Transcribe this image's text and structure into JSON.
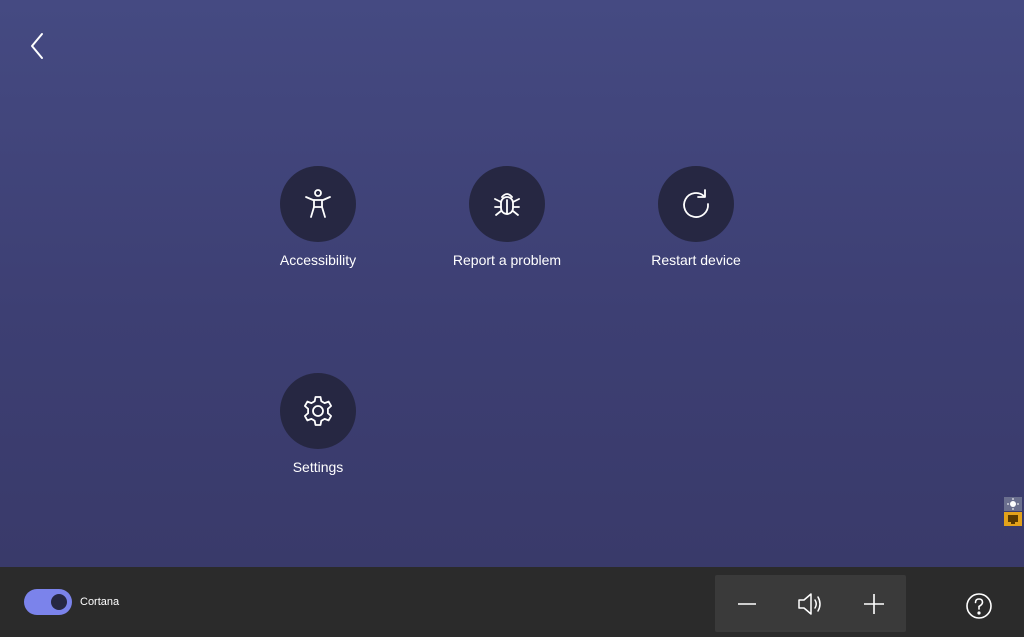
{
  "nav": {
    "back_icon": "chevron-left-icon"
  },
  "tiles": [
    {
      "label": "Accessibility",
      "icon": "accessibility-icon"
    },
    {
      "label": "Report a problem",
      "icon": "bug-icon"
    },
    {
      "label": "Restart device",
      "icon": "restart-icon"
    },
    {
      "label": "Settings",
      "icon": "gear-icon"
    }
  ],
  "bottom_bar": {
    "cortana_toggle": {
      "label": "Cortana",
      "state": "on",
      "color": "#7b83eb"
    },
    "volume": {
      "decrease_icon": "minus-icon",
      "speaker_icon": "speaker-icon",
      "increase_icon": "plus-icon"
    },
    "help_icon": "help-icon"
  },
  "colors": {
    "background_top": "#454a82",
    "background_bottom": "#393a6a",
    "tile_circle": "#262742",
    "bar": "#2b2b2b"
  }
}
